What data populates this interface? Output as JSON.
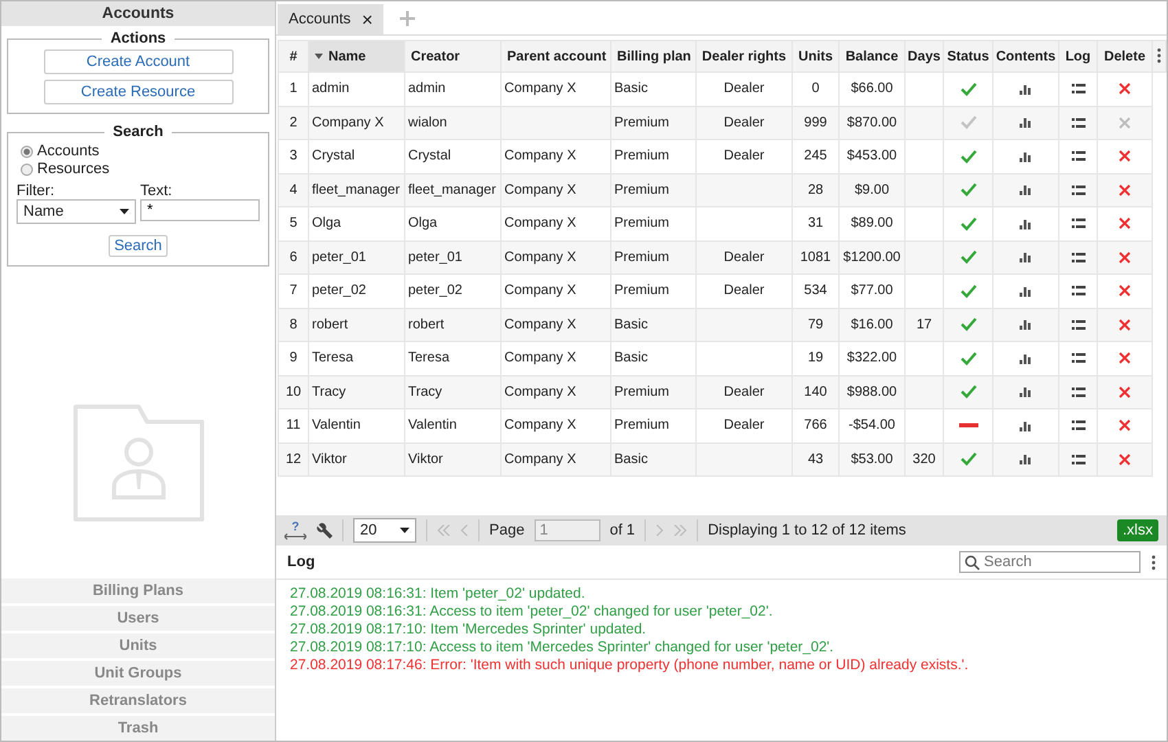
{
  "sidebar": {
    "title": "Accounts",
    "actions": {
      "legend": "Actions",
      "buttons": [
        "Create Account",
        "Create Resource"
      ]
    },
    "search": {
      "legend": "Search",
      "options": [
        {
          "label": "Accounts",
          "selected": true
        },
        {
          "label": "Resources",
          "selected": false
        }
      ],
      "filter_label": "Filter:",
      "filter_value": "Name",
      "text_label": "Text:",
      "text_value": "*",
      "button": "Search"
    },
    "nav": [
      "Billing Plans",
      "Users",
      "Units",
      "Unit Groups",
      "Retranslators",
      "Trash"
    ]
  },
  "tabs": [
    {
      "label": "Accounts",
      "selected": true,
      "close": "×"
    }
  ],
  "table": {
    "columns": [
      {
        "label": "#",
        "sorted": false
      },
      {
        "label": "Name",
        "sorted": true
      },
      {
        "label": "Creator",
        "sorted": false
      },
      {
        "label": "Parent account",
        "sorted": false
      },
      {
        "label": "Billing plan",
        "sorted": false
      },
      {
        "label": "Dealer rights",
        "sorted": false
      },
      {
        "label": "Units",
        "sorted": false
      },
      {
        "label": "Balance",
        "sorted": false
      },
      {
        "label": "Days",
        "sorted": false
      },
      {
        "label": "Status",
        "sorted": false
      },
      {
        "label": "Contents",
        "sorted": false
      },
      {
        "label": "Log",
        "sorted": false
      },
      {
        "label": "Delete",
        "sorted": false
      }
    ],
    "rows": [
      {
        "num": "1",
        "name": "admin",
        "creator": "admin",
        "parent": "Company X",
        "plan": "Basic",
        "dealer": "Dealer",
        "units": "0",
        "balance": "$66.00",
        "days": "",
        "kind": "active",
        "deletable": true
      },
      {
        "num": "2",
        "name": "Company X",
        "creator": "wialon",
        "parent": "",
        "plan": "Premium",
        "dealer": "Dealer",
        "units": "999",
        "balance": "$870.00",
        "days": "",
        "kind": "inactive",
        "deletable": false
      },
      {
        "num": "3",
        "name": "Crystal",
        "creator": "Crystal",
        "parent": "Company X",
        "plan": "Premium",
        "dealer": "Dealer",
        "units": "245",
        "balance": "$453.00",
        "days": "",
        "kind": "active",
        "deletable": true
      },
      {
        "num": "4",
        "name": "fleet_manager",
        "creator": "fleet_manager",
        "parent": "Company X",
        "plan": "Premium",
        "dealer": "",
        "units": "28",
        "balance": "$9.00",
        "days": "",
        "kind": "active",
        "deletable": true
      },
      {
        "num": "5",
        "name": "Olga",
        "creator": "Olga",
        "parent": "Company X",
        "plan": "Premium",
        "dealer": "",
        "units": "31",
        "balance": "$89.00",
        "days": "",
        "kind": "active",
        "deletable": true
      },
      {
        "num": "6",
        "name": "peter_01",
        "creator": "peter_01",
        "parent": "Company X",
        "plan": "Premium",
        "dealer": "Dealer",
        "units": "1081",
        "balance": "$1200.00",
        "days": "",
        "kind": "active",
        "deletable": true
      },
      {
        "num": "7",
        "name": "peter_02",
        "creator": "peter_02",
        "parent": "Company X",
        "plan": "Premium",
        "dealer": "Dealer",
        "units": "534",
        "balance": "$77.00",
        "days": "",
        "kind": "active",
        "deletable": true
      },
      {
        "num": "8",
        "name": "robert",
        "creator": "robert",
        "parent": "Company X",
        "plan": "Basic",
        "dealer": "",
        "units": "79",
        "balance": "$16.00",
        "days": "17",
        "kind": "active",
        "deletable": true
      },
      {
        "num": "9",
        "name": "Teresa",
        "creator": "Teresa",
        "parent": "Company X",
        "plan": "Basic",
        "dealer": "",
        "units": "19",
        "balance": "$322.00",
        "days": "",
        "kind": "active",
        "deletable": true
      },
      {
        "num": "10",
        "name": "Tracy",
        "creator": "Tracy",
        "parent": "Company X",
        "plan": "Premium",
        "dealer": "Dealer",
        "units": "140",
        "balance": "$988.00",
        "days": "",
        "kind": "active",
        "deletable": true
      },
      {
        "num": "11",
        "name": "Valentin",
        "creator": "Valentin",
        "parent": "Company X",
        "plan": "Premium",
        "dealer": "Dealer",
        "units": "766",
        "balance": "-$54.00",
        "days": "",
        "kind": "blocked",
        "deletable": true
      },
      {
        "num": "12",
        "name": "Viktor",
        "creator": "Viktor",
        "parent": "Company X",
        "plan": "Basic",
        "dealer": "",
        "units": "43",
        "balance": "$53.00",
        "days": "320",
        "kind": "active",
        "deletable": true
      }
    ]
  },
  "pager": {
    "help_mark": "?",
    "page_size": "20",
    "page_label": "Page",
    "page": "1",
    "of": "of 1",
    "info": "Displaying 1 to 12 of 12 items",
    "export": ".xlsx"
  },
  "log": {
    "title": "Log",
    "search_placeholder": "Search",
    "lines": [
      {
        "text": "27.08.2019 08:16:31: Item 'peter_02' updated.",
        "kind": "info"
      },
      {
        "text": "27.08.2019 08:16:31: Access to item 'peter_02' changed for user 'peter_02'.",
        "kind": "info"
      },
      {
        "text": "27.08.2019 08:17:10: Item 'Mercedes Sprinter' updated.",
        "kind": "info"
      },
      {
        "text": "27.08.2019 08:17:10: Access to item 'Mercedes Sprinter' changed for user 'peter_02'.",
        "kind": "info"
      },
      {
        "text": "27.08.2019 08:17:46: Error: 'Item with such unique property (phone number, name or UID) already exists.'.",
        "kind": "error"
      }
    ]
  }
}
